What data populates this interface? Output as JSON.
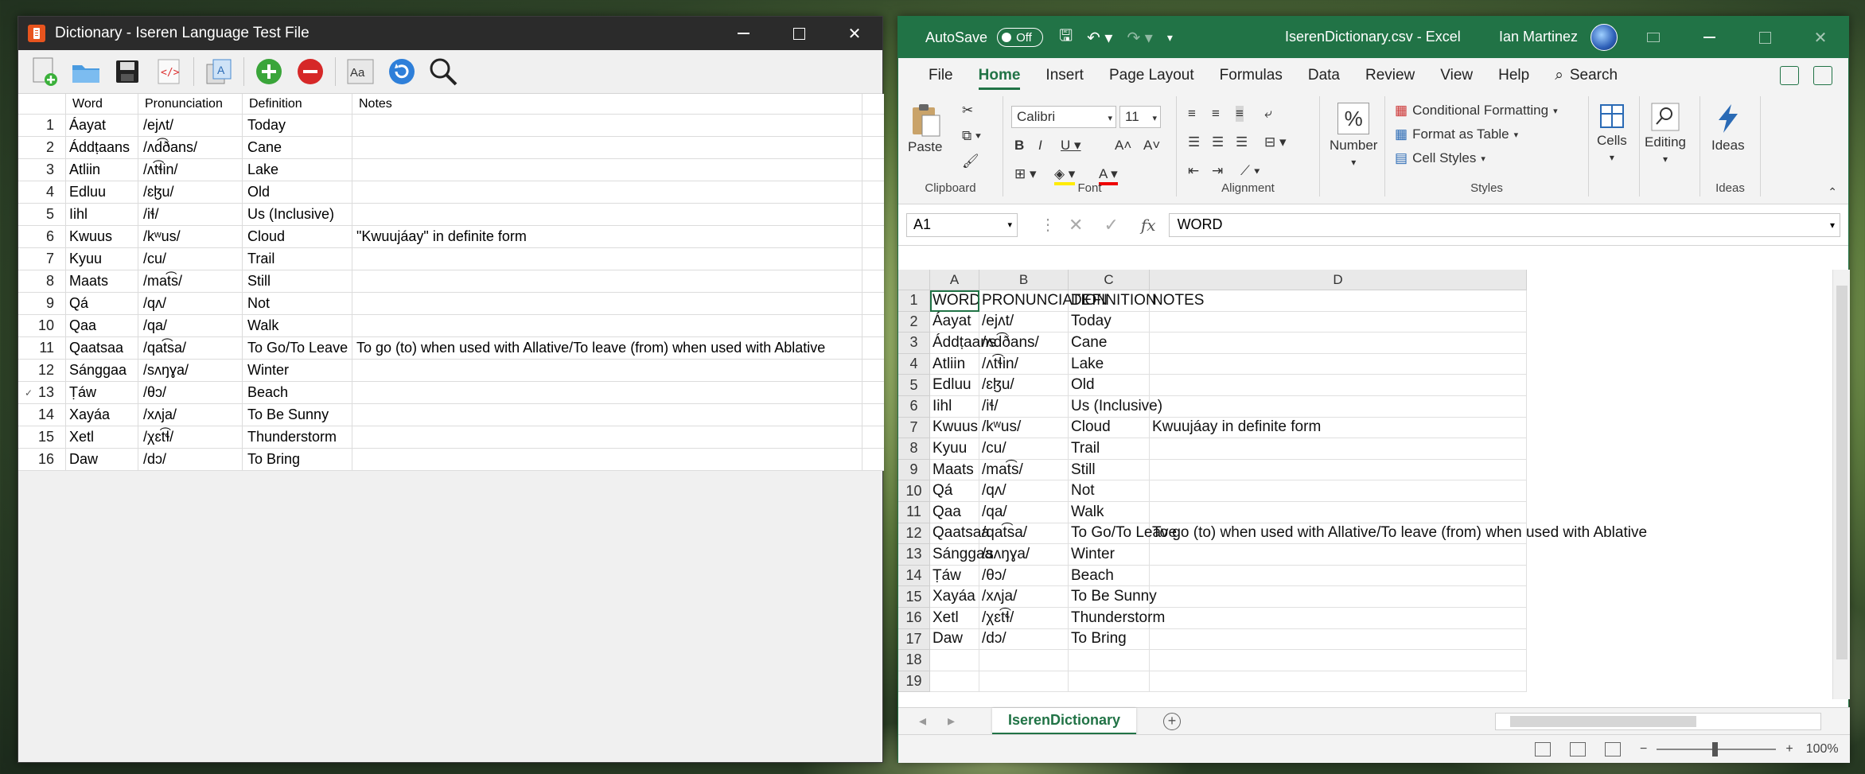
{
  "dictionary_app": {
    "title": "Dictionary - Iseren Language Test File",
    "columns": [
      "Word",
      "Pronunciation",
      "Definition",
      "Notes"
    ],
    "rows": [
      {
        "num": "1",
        "word": "Áayat",
        "pron": "/ejʌt/",
        "def": "Today",
        "notes": ""
      },
      {
        "num": "2",
        "word": "Áddṭaans",
        "pron": "/ʌd͡ðans/",
        "def": "Cane",
        "notes": ""
      },
      {
        "num": "3",
        "word": "Atliin",
        "pron": "/ʌt͡ɬin/",
        "def": "Lake",
        "notes": ""
      },
      {
        "num": "4",
        "word": "Edluu",
        "pron": "/ɛɮu/",
        "def": "Old",
        "notes": ""
      },
      {
        "num": "5",
        "word": "Iihl",
        "pron": "/iɬ/",
        "def": "Us (Inclusive)",
        "notes": ""
      },
      {
        "num": "6",
        "word": "Kwuus",
        "pron": "/kʷus/",
        "def": "Cloud",
        "notes": "\"Kwuujáay\" in definite form"
      },
      {
        "num": "7",
        "word": "Kyuu",
        "pron": "/cu/",
        "def": "Trail",
        "notes": ""
      },
      {
        "num": "8",
        "word": "Maats",
        "pron": "/mat͡s/",
        "def": "Still",
        "notes": ""
      },
      {
        "num": "9",
        "word": "Qá",
        "pron": "/qʌ/",
        "def": "Not",
        "notes": ""
      },
      {
        "num": "10",
        "word": "Qaa",
        "pron": "/qa/",
        "def": "Walk",
        "notes": ""
      },
      {
        "num": "11",
        "word": "Qaatsaa",
        "pron": "/qat͡sa/",
        "def": "To Go/To Leave",
        "notes": "To go (to) when used with Allative/To leave (from) when used with Ablative"
      },
      {
        "num": "12",
        "word": "Sánggaa",
        "pron": "/sʌŋɣa/",
        "def": "Winter",
        "notes": ""
      },
      {
        "num": "13",
        "word": "Ṭáw",
        "pron": "/θɔ/",
        "def": "Beach",
        "notes": ""
      },
      {
        "num": "14",
        "word": "Xayáa",
        "pron": "/xʌja/",
        "def": "To Be Sunny",
        "notes": ""
      },
      {
        "num": "15",
        "word": "Xetl",
        "pron": "/χɛt͡ɬ/",
        "def": "Thunderstorm",
        "notes": ""
      },
      {
        "num": "16",
        "word": "Daw",
        "pron": "/dɔ/",
        "def": "To Bring",
        "notes": ""
      }
    ]
  },
  "excel": {
    "autosave_label": "AutoSave",
    "autosave_state": "Off",
    "filename": "IserenDictionary.csv  -  Excel",
    "user": "Ian Martinez",
    "tabs": [
      "File",
      "Home",
      "Insert",
      "Page Layout",
      "Formulas",
      "Data",
      "Review",
      "View",
      "Help"
    ],
    "search_label": "Search",
    "ribbon": {
      "paste": "Paste",
      "clipboard": "Clipboard",
      "font_name": "Calibri",
      "font_size": "11",
      "font_group": "Font",
      "alignment_group": "Alignment",
      "number": "Number",
      "conditional_formatting": "Conditional Formatting",
      "format_as_table": "Format as Table",
      "cell_styles": "Cell Styles",
      "styles_group": "Styles",
      "cells": "Cells",
      "editing": "Editing",
      "ideas": "Ideas",
      "ideas_group": "Ideas"
    },
    "name_box": "A1",
    "formula": "WORD",
    "col_letters": [
      "A",
      "B",
      "C",
      "D"
    ],
    "row_numbers": [
      "1",
      "2",
      "3",
      "4",
      "5",
      "6",
      "7",
      "8",
      "9",
      "10",
      "11",
      "12",
      "13",
      "14",
      "15",
      "16",
      "17",
      "18",
      "19"
    ],
    "cells": [
      [
        "WORD",
        "PRONUNCIATION",
        "DEFINITION",
        "NOTES"
      ],
      [
        "Áayat",
        "/ejʌt/",
        "Today",
        ""
      ],
      [
        "Áddṭaans",
        "/ʌd͡ðans/",
        "Cane",
        ""
      ],
      [
        "Atliin",
        "/ʌt͡ɬin/",
        "Lake",
        ""
      ],
      [
        "Edluu",
        "/ɛɮu/",
        "Old",
        ""
      ],
      [
        "Iihl",
        "/iɬ/",
        "Us (Inclusive)",
        ""
      ],
      [
        "Kwuus",
        "/kʷus/",
        "Cloud",
        "Kwuujáay in definite form"
      ],
      [
        "Kyuu",
        "/cu/",
        "Trail",
        ""
      ],
      [
        "Maats",
        "/mat͡s/",
        "Still",
        ""
      ],
      [
        "Qá",
        "/qʌ/",
        "Not",
        ""
      ],
      [
        "Qaa",
        "/qa/",
        "Walk",
        ""
      ],
      [
        "Qaatsaa",
        "/qat͡sa/",
        "To Go/To Leave",
        "To go (to) when used with Allative/To leave (from) when used with Ablative"
      ],
      [
        "Sánggaa",
        "/sʌŋɣa/",
        "Winter",
        ""
      ],
      [
        "Ṭáw",
        "/θɔ/",
        "Beach",
        ""
      ],
      [
        "Xayáa",
        "/xʌja/",
        "To Be Sunny",
        ""
      ],
      [
        "Xetl",
        "/χɛt͡ɬ/",
        "Thunderstorm",
        ""
      ],
      [
        "Daw",
        "/dɔ/",
        "To Bring",
        ""
      ]
    ],
    "sheet_tab": "IserenDictionary",
    "zoom": "100%"
  }
}
